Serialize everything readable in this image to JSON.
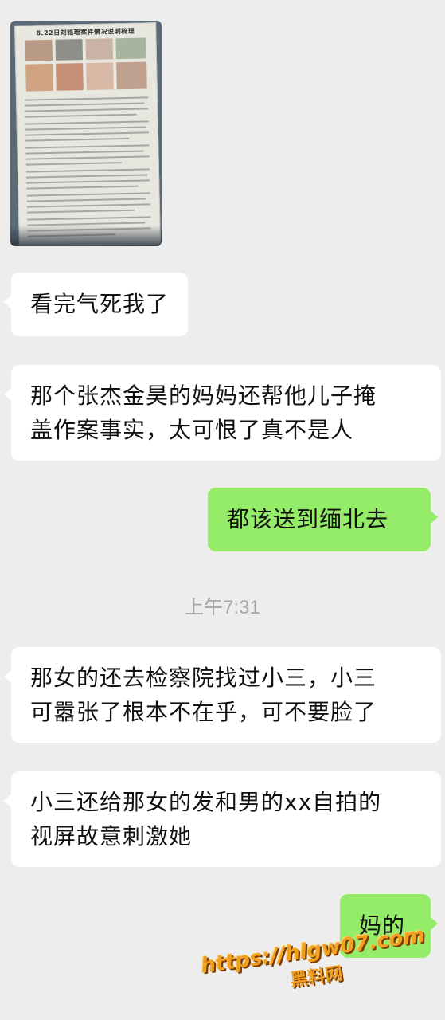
{
  "chat": {
    "photo": {
      "title": "8.22日刘铭瑶案件情况说明梳理"
    },
    "messages": [
      {
        "side": "left",
        "text": "看完气死我了"
      },
      {
        "side": "left",
        "line1": "那个张杰金昊的妈妈还帮他儿子掩",
        "line2": "盖作案事实，太可恨了真不是人"
      },
      {
        "side": "right",
        "text": "都该送到缅北去"
      },
      {
        "side": "left",
        "line1": "那女的还去检察院找过小三，小三",
        "line2": "可嚣张了根本不在乎，可不要脸了"
      },
      {
        "side": "left",
        "line1": "小三还给那女的发和男的xx自拍的",
        "line2": "视屏故意刺激她"
      },
      {
        "side": "right",
        "text": "妈的"
      }
    ],
    "timestamp": "上午7:31"
  },
  "watermark": {
    "url": "https://hlgw07.com",
    "name": "黑料网"
  },
  "colors": {
    "background": "#ededed",
    "incoming_bubble": "#ffffff",
    "outgoing_bubble": "#95ec69",
    "timestamp_text": "#a6a6a6",
    "watermark": "#f2a020"
  }
}
